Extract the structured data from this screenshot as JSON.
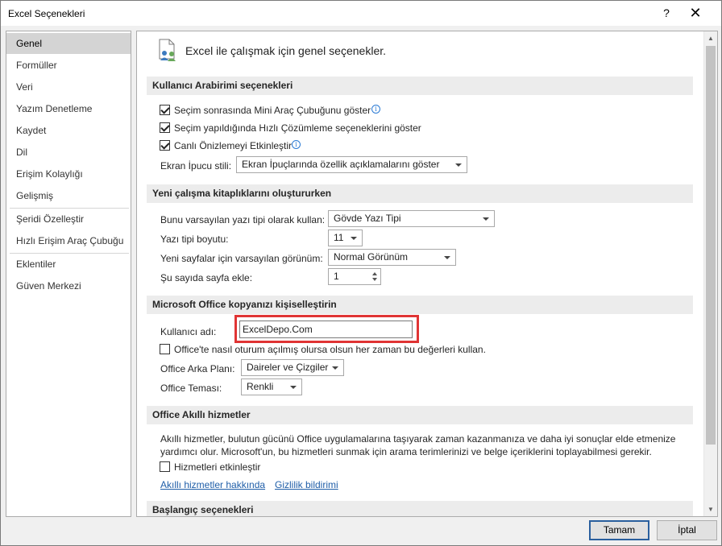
{
  "window": {
    "title": "Excel Seçenekleri",
    "help": "?",
    "close": "✕"
  },
  "nav": {
    "items": [
      {
        "label": "Genel"
      },
      {
        "label": "Formüller"
      },
      {
        "label": "Veri"
      },
      {
        "label": "Yazım Denetleme"
      },
      {
        "label": "Kaydet"
      },
      {
        "label": "Dil"
      },
      {
        "label": "Erişim Kolaylığı"
      },
      {
        "label": "Gelişmiş"
      },
      {
        "label": "Şeridi Özelleştir"
      },
      {
        "label": "Hızlı Erişim Araç Çubuğu"
      },
      {
        "label": "Eklentiler"
      },
      {
        "label": "Güven Merkezi"
      }
    ],
    "active": "Genel"
  },
  "header": {
    "text": "Excel ile çalışmak için genel seçenekler."
  },
  "ui_options": {
    "title": "Kullanıcı Arabirimi seçenekleri",
    "mini_toolbar": {
      "label": "Seçim sonrasında Mini Araç Çubuğunu göster",
      "checked": true
    },
    "quick_analysis": {
      "label": "Seçim yapıldığında Hızlı Çözümleme seçeneklerini göster",
      "checked": true
    },
    "live_preview": {
      "label": "Canlı Önizlemeyi Etkinleştir",
      "checked": true
    },
    "screentip_label": "Ekran İpucu stili:",
    "screentip_value": "Ekran İpuçlarında özellik açıklamalarını göster"
  },
  "new_workbooks": {
    "title": "Yeni çalışma kitaplıklarını oluştururken",
    "font_label": "Bunu varsayılan yazı tipi olarak kullan:",
    "font_value": "Gövde Yazı Tipi",
    "size_label": "Yazı tipi boyutu:",
    "size_value": "11",
    "view_label": "Yeni sayfalar için varsayılan görünüm:",
    "view_value": "Normal Görünüm",
    "sheets_label": "Şu sayıda sayfa ekle:",
    "sheets_value": "1"
  },
  "personalize": {
    "title": "Microsoft Office kopyanızı kişiselleştirin",
    "username_label": "Kullanıcı adı:",
    "username_value": "ExcelDepo.Com",
    "always_use": {
      "label": "Office'te nasıl oturum açılmış olursa olsun her zaman bu değerleri kullan.",
      "checked": false
    },
    "background_label": "Office Arka Planı:",
    "background_value": "Daireler ve Çizgiler",
    "theme_label": "Office Teması:",
    "theme_value": "Renkli"
  },
  "intelligent": {
    "title": "Office Akıllı hizmetler",
    "description_line1": "Akıllı hizmetler, bulutun gücünü Office uygulamalarına taşıyarak zaman kazanmanıza ve daha iyi sonuçlar elde etmenize",
    "description_line2": "yardımcı olur. Microsoft'un, bu hizmetleri sunmak için arama terimlerinizi ve belge içeriklerini toplayabilmesi gerekir.",
    "enable": {
      "label": "Hizmetleri etkinleştir",
      "checked": false
    },
    "about_link": "Akıllı hizmetler hakkında",
    "privacy_link": "Gizlilik bildirimi"
  },
  "startup": {
    "title": "Başlangıç seçenekleri"
  },
  "buttons": {
    "ok": "Tamam",
    "cancel": "İptal"
  },
  "colors": {
    "highlight": "#e03434",
    "link": "#1f5ea8",
    "info": "#2a7ad4"
  }
}
